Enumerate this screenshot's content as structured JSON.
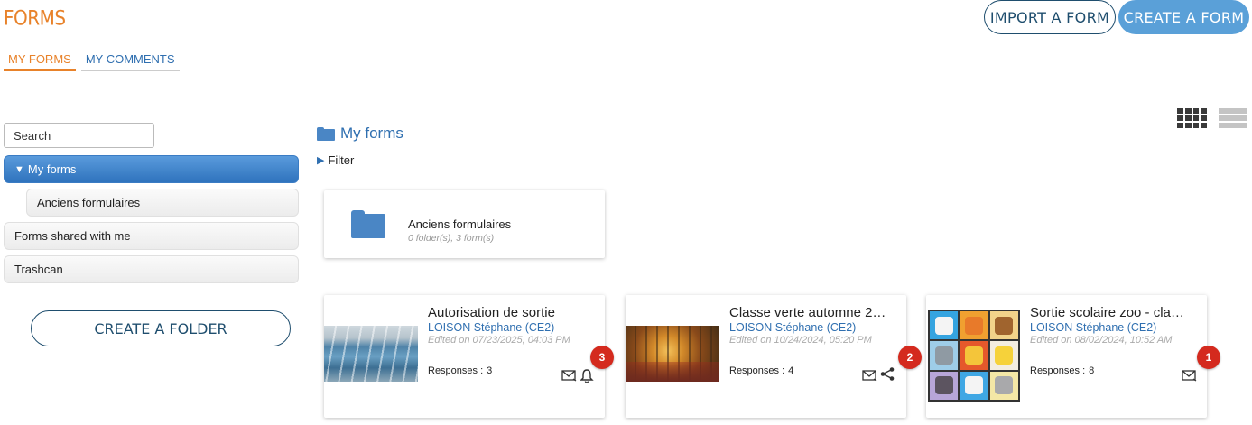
{
  "app": {
    "title": "FORMS"
  },
  "header": {
    "import_label": "IMPORT A FORM",
    "create_label": "CREATE A FORM"
  },
  "tabs": [
    {
      "label": "MY FORMS"
    },
    {
      "label": "MY COMMENTS"
    }
  ],
  "sidebar": {
    "search_placeholder": "Search",
    "items": [
      {
        "label": "My forms"
      },
      {
        "label": "Anciens formulaires"
      },
      {
        "label": "Forms shared with me"
      },
      {
        "label": "Trashcan"
      }
    ],
    "create_folder_label": "CREATE A FOLDER"
  },
  "main": {
    "breadcrumb": "My forms",
    "filter_label": "Filter",
    "folder": {
      "name": "Anciens formulaires",
      "meta": "0 folder(s), 3 form(s)"
    },
    "responses_label": "Responses :",
    "forms": [
      {
        "title": "Autorisation de sortie",
        "owner": "LOISON Stéphane (CE2)",
        "edited": "Edited on 07/23/2025, 04:03 PM",
        "responses": "3",
        "badge": "3",
        "action_icon": "bell-icon"
      },
      {
        "title": "Classe verte automne 2…",
        "owner": "LOISON Stéphane (CE2)",
        "edited": "Edited on 10/24/2024, 05:20 PM",
        "responses": "4",
        "badge": "2",
        "action_icon": "share-icon"
      },
      {
        "title": "Sortie scolaire zoo - cla…",
        "owner": "LOISON Stéphane (CE2)",
        "edited": "Edited on 08/02/2024, 10:52 AM",
        "responses": "8",
        "badge": "1",
        "action_icon": "none"
      }
    ]
  },
  "colors": {
    "orange": "#e8822a",
    "blue": "#2f6fb0",
    "badge": "#d42a1e",
    "folder": "#4a86c5"
  }
}
